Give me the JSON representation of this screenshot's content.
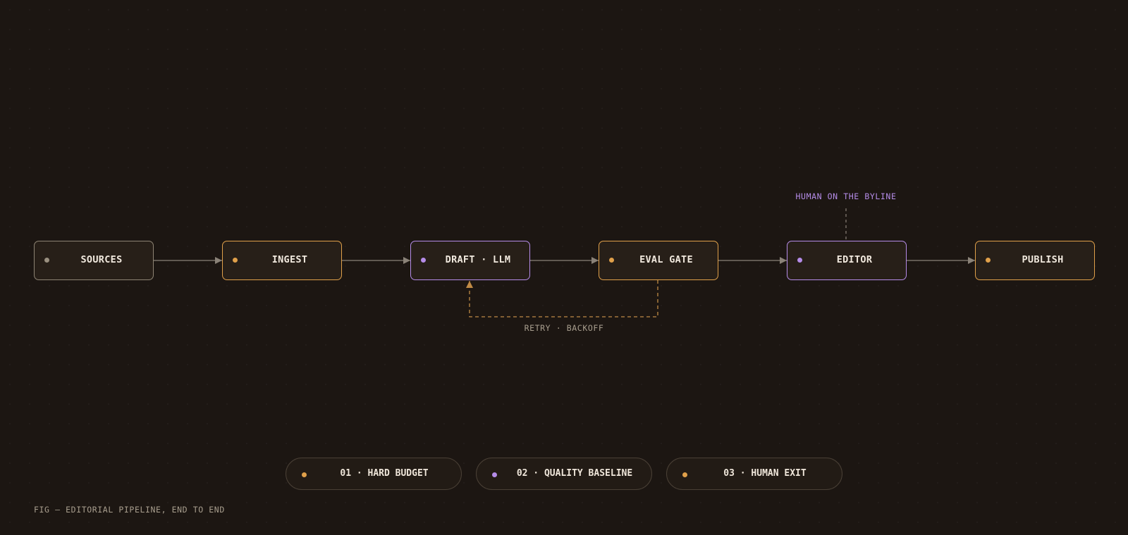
{
  "colors": {
    "background": "#1c1612",
    "node_fill": "#271f18",
    "amber": "#e0a04a",
    "violet": "#b58ce8",
    "muted": "#8e8474",
    "connector": "#8a8278",
    "text": "#f1e9de"
  },
  "pipeline": {
    "nodes": [
      {
        "id": "sources",
        "label": "SOURCES",
        "accent": "muted"
      },
      {
        "id": "ingest",
        "label": "INGEST",
        "accent": "amber"
      },
      {
        "id": "draft",
        "label": "DRAFT · LLM",
        "accent": "violet"
      },
      {
        "id": "eval",
        "label": "EVAL GATE",
        "accent": "amber"
      },
      {
        "id": "editor",
        "label": "EDITOR",
        "accent": "violet"
      },
      {
        "id": "publish",
        "label": "PUBLISH",
        "accent": "amber"
      }
    ],
    "edges": [
      {
        "from": "sources",
        "to": "ingest",
        "style": "solid"
      },
      {
        "from": "ingest",
        "to": "draft",
        "style": "solid"
      },
      {
        "from": "draft",
        "to": "eval",
        "style": "solid"
      },
      {
        "from": "eval",
        "to": "editor",
        "style": "solid"
      },
      {
        "from": "editor",
        "to": "publish",
        "style": "solid"
      },
      {
        "from": "eval",
        "to": "draft",
        "style": "dashed",
        "label": "RETRY · BACKOFF"
      }
    ],
    "annotations": {
      "editor_note": "HUMAN ON THE BYLINE",
      "retry_note": "RETRY · BACKOFF"
    }
  },
  "principles": [
    {
      "label": "01 · HARD BUDGET",
      "accent": "amber"
    },
    {
      "label": "02 · QUALITY BASELINE",
      "accent": "violet"
    },
    {
      "label": "03 · HUMAN EXIT",
      "accent": "amber"
    }
  ],
  "caption": "FIG — EDITORIAL PIPELINE, END TO END"
}
